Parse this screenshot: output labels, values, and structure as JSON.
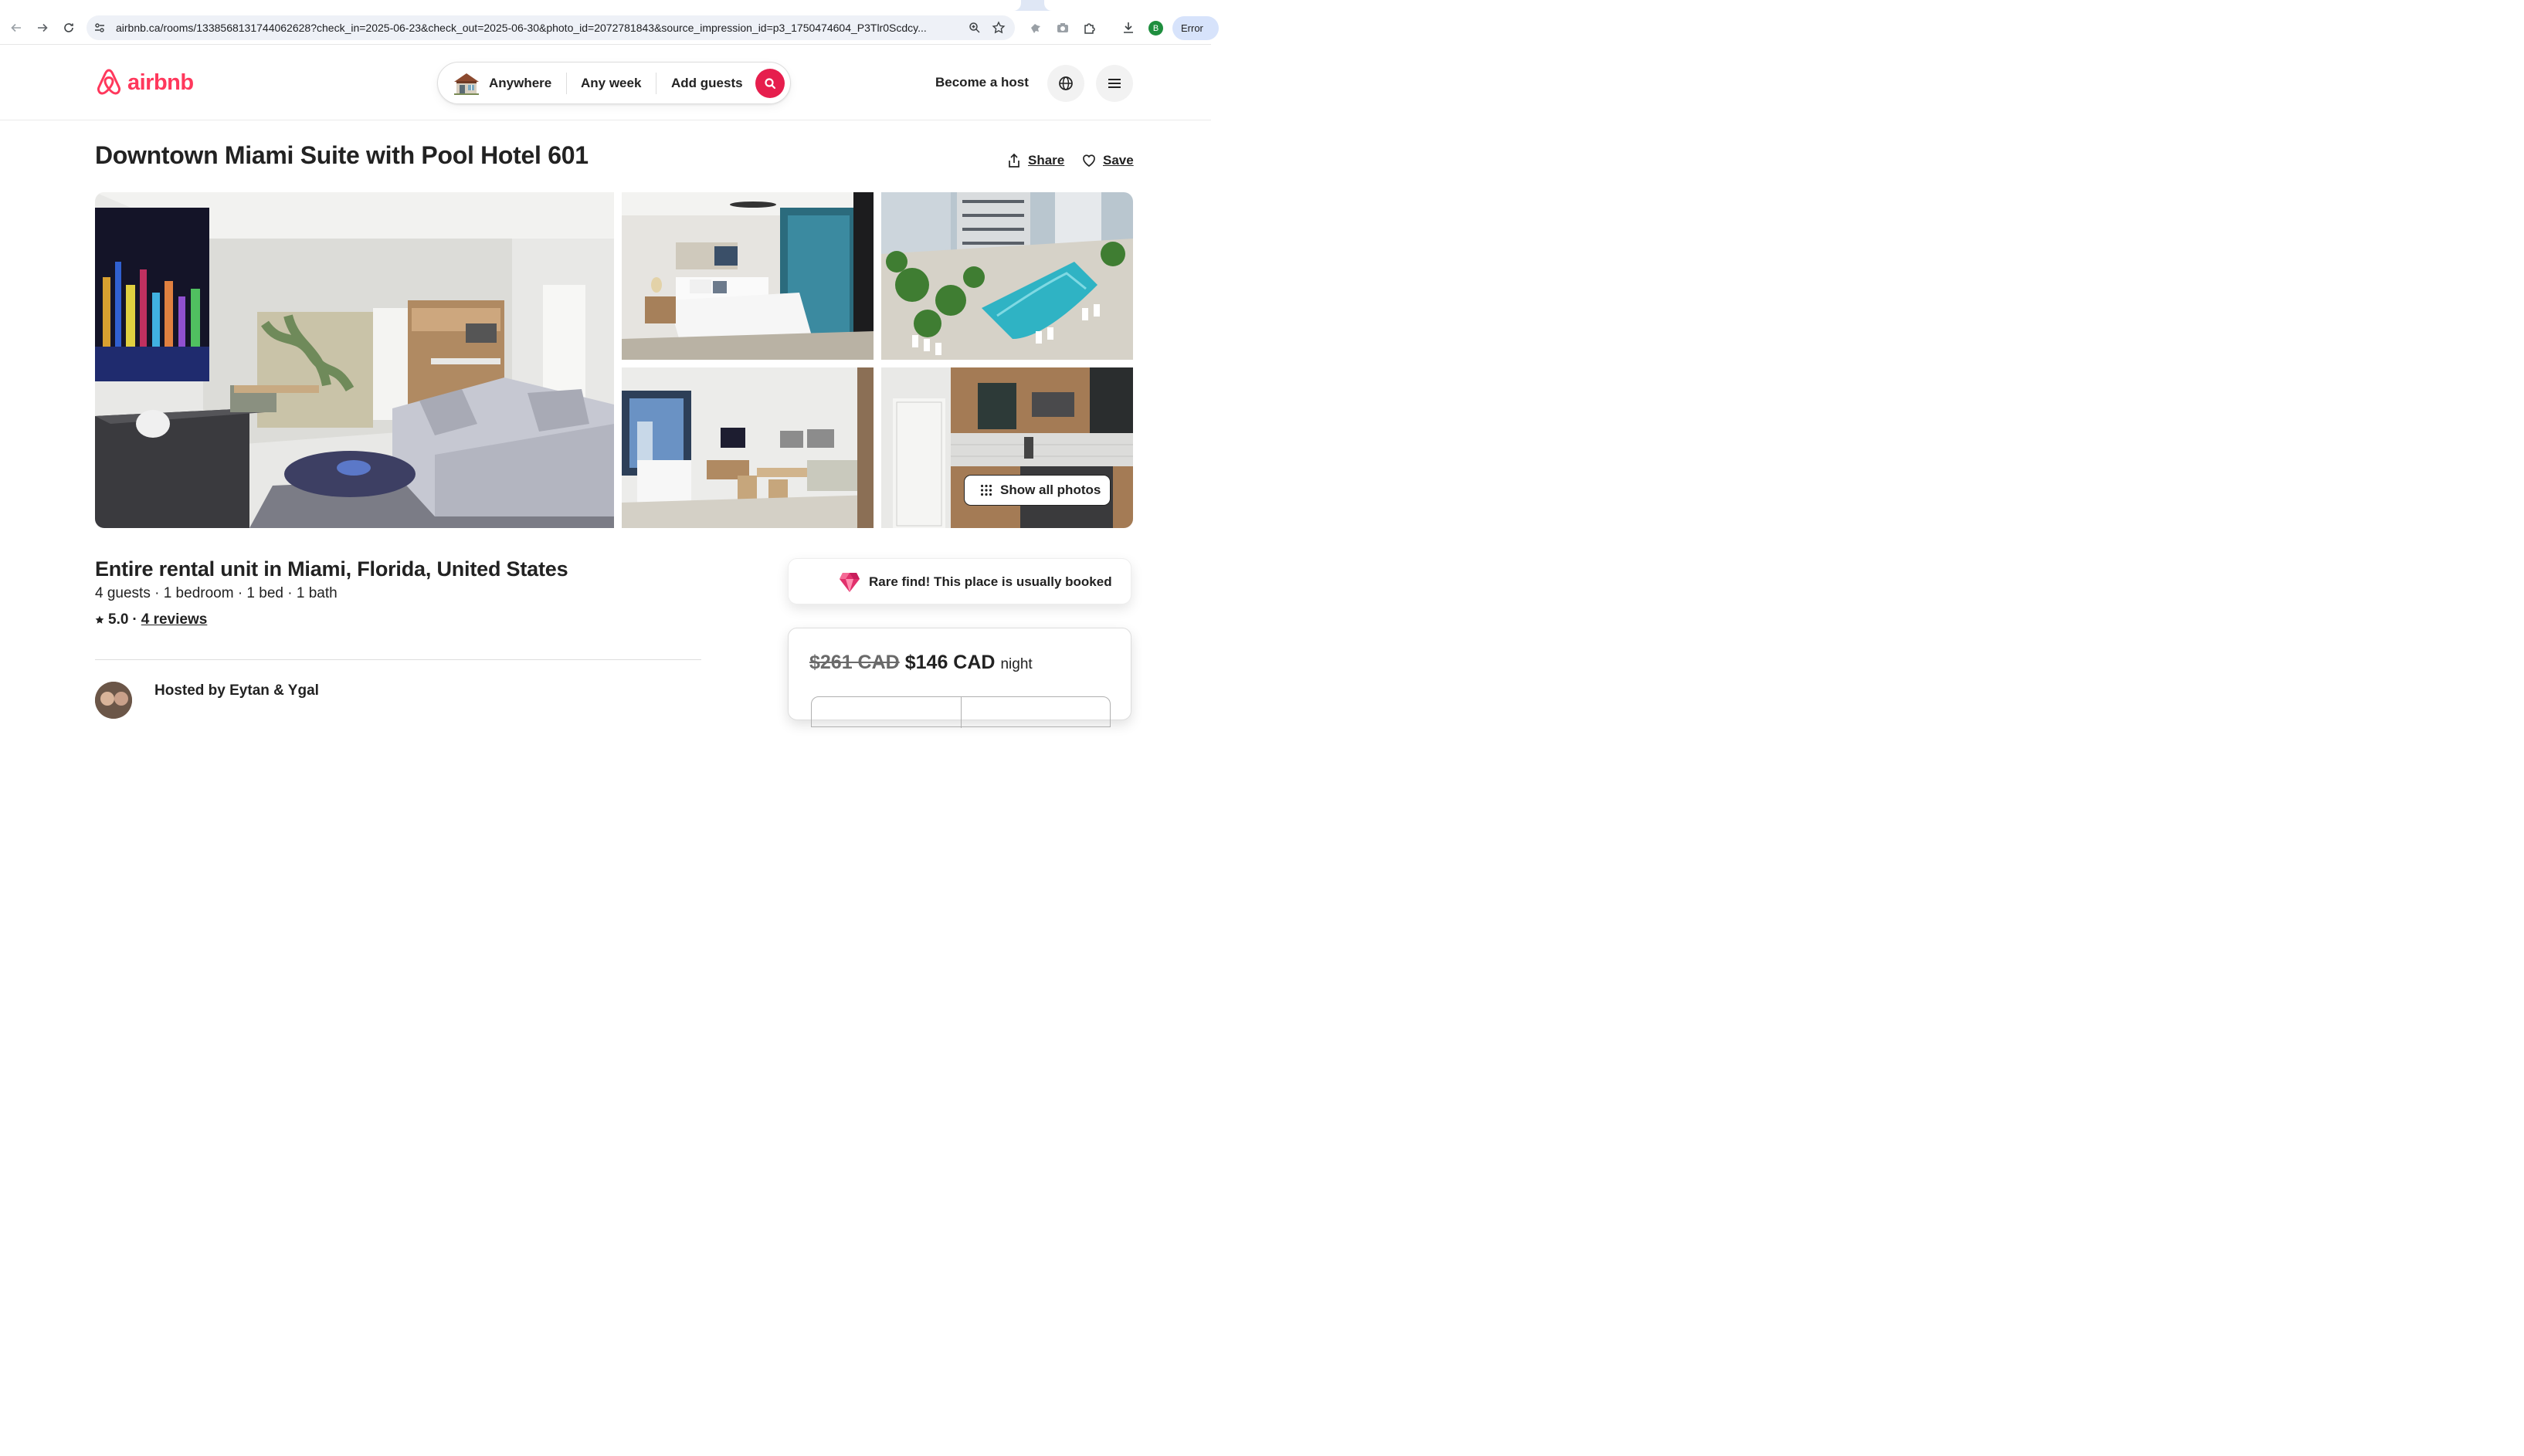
{
  "browser": {
    "url_host": "airbnb.ca",
    "url_path": "/rooms/1338568131744062628?check_in=2025-06-23&check_out=2025-06-30&photo_id=2072781843&source_impression_id=p3_1750474604_P3Tlr0Scdcy...",
    "profile_initial": "B",
    "error_label": "Error"
  },
  "header": {
    "logo_text": "airbnb",
    "search": {
      "where": "Anywhere",
      "when": "Any week",
      "who": "Add guests"
    },
    "become_host": "Become a host"
  },
  "listing": {
    "title": "Downtown Miami Suite with Pool Hotel 601",
    "share_label": "Share",
    "save_label": "Save",
    "show_all_photos": "Show all photos",
    "subtitle": "Entire rental unit in Miami, Florida, United States",
    "specs": "4 guests · 1 bedroom · 1 bed · 1 bath",
    "rating": "5.0",
    "rating_separator": "·",
    "reviews_link": "4 reviews",
    "hosted_by": "Hosted by Eytan & Ygal"
  },
  "booking": {
    "rare_find": "Rare find! This place is usually booked",
    "old_price": "$261 CAD",
    "new_price": "$146 CAD",
    "per": "night"
  },
  "colors": {
    "brand": "#ff385c",
    "search_button": "#e61e4d",
    "text": "#222222"
  }
}
